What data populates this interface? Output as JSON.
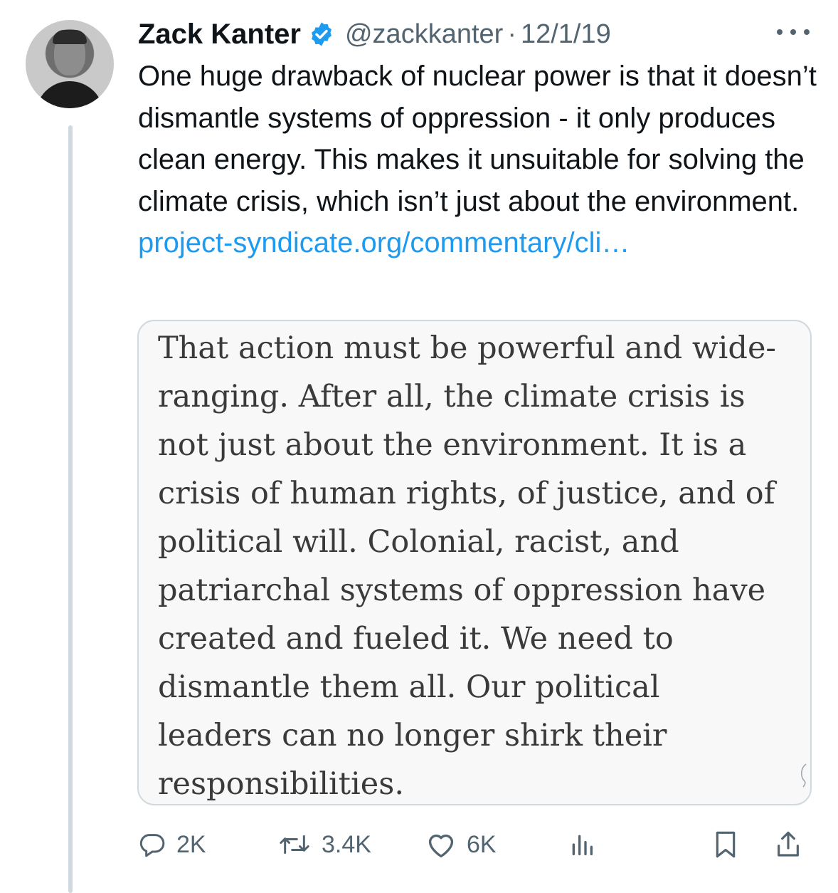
{
  "author": {
    "name": "Zack Kanter",
    "handle": "@zackkanter",
    "separator": "·",
    "date": "12/1/19",
    "verified": true,
    "avatar_icon": "profile-photo"
  },
  "tweet": {
    "text": "One huge drawback of nuclear power is that it doesn’t dismantle systems of oppression - it only produces clean energy. This makes it unsuitable for solving the climate crisis, which isn’t just about the environment.",
    "link_text": "project-syndicate.org/commentary/cli…"
  },
  "quote_image_text": "That action must be powerful and wide-\nranging. After all, the climate crisis is\nnot just about the environment. It is a\ncrisis of human rights, of justice, and of\npolitical will. Colonial, racist, and\npatriarchal systems of oppression have\ncreated and fueled it. We need to\ndismantle them all. Our political\nleaders can no longer shirk their\nresponsibilities.",
  "actions": {
    "replies": "2K",
    "retweets": "3.4K",
    "likes": "6K"
  },
  "colors": {
    "text": "#0f1419",
    "secondary": "#536471",
    "link": "#1d9bf0",
    "verified_badge": "#1d9bf0",
    "border": "#cfd9de"
  }
}
